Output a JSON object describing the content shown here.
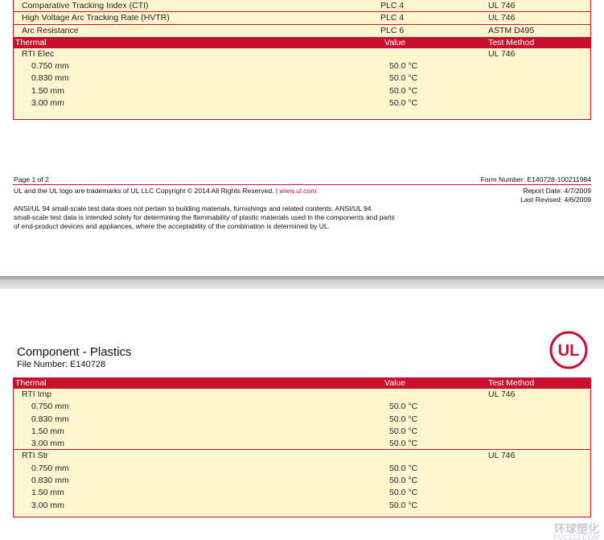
{
  "page1": {
    "top_rows": [
      {
        "property": "Comparative Tracking Index (CTI)",
        "value": "PLC 4",
        "method": "UL 746"
      },
      {
        "property": "High Voltage Arc Tracking Rate (HVTR)",
        "value": "PLC 4",
        "method": "UL 746"
      },
      {
        "property": "Arc Resistance",
        "value": "PLC 6",
        "method": "ASTM D495"
      }
    ],
    "header": {
      "col1": "Thermal",
      "col2": "Value",
      "col3": "Test Method"
    },
    "group": {
      "name": "RTI Elec",
      "method": "UL 746",
      "rows": [
        {
          "thickness": "0.750 mm",
          "value": "50.0 °C"
        },
        {
          "thickness": "0.830 mm",
          "value": "50.0 °C"
        },
        {
          "thickness": "1.50 mm",
          "value": "50.0 °C"
        },
        {
          "thickness": "3.00 mm",
          "value": "50.0 °C"
        }
      ]
    },
    "footer": {
      "page": "Page 1 of 2",
      "form_number": "Form Number: E140728-100211984",
      "trademark": "UL and the UL logo are trademarks of UL LLC Copyright © 2014 All Rights Reserved. |",
      "link": "www.ul.com",
      "report_date": "Report Date: 4/7/2009",
      "last_revised": "Last Revised: 4/6/2009",
      "disclaimer_1": "ANSI/UL 94 small-scale test data does not pertain to building materials, furnishings and related contents. ANSI/UL 94",
      "disclaimer_2": "small-scale test data is intended solely for determining the flammability of plastic materials used in the components and parts",
      "disclaimer_3": "of end-product devices and appliances, where the acceptability of the combination is determined by UL."
    }
  },
  "page2": {
    "title": "Component - Plastics",
    "file_number": "File Number: E140728",
    "logo_text": "UL",
    "header": {
      "col1": "Thermal",
      "col2": "Value",
      "col3": "Test Method"
    },
    "groups": [
      {
        "name": "RTI Imp",
        "method": "UL 746",
        "rows": [
          {
            "thickness": "0.750 mm",
            "value": "50.0 °C"
          },
          {
            "thickness": "0.830 mm",
            "value": "50.0 °C"
          },
          {
            "thickness": "1.50 mm",
            "value": "50.0 °C"
          },
          {
            "thickness": "3.00 mm",
            "value": "50.0 °C"
          }
        ]
      },
      {
        "name": "RTI Str",
        "method": "UL 746",
        "rows": [
          {
            "thickness": "0.750 mm",
            "value": "50.0 °C"
          },
          {
            "thickness": "0.830 mm",
            "value": "50.0 °C"
          },
          {
            "thickness": "1.50 mm",
            "value": "50.0 °C"
          },
          {
            "thickness": "3.00 mm",
            "value": "50.0 °C"
          }
        ]
      }
    ]
  },
  "watermark": {
    "text": "环球塑化",
    "url": "PVC123.COM"
  }
}
